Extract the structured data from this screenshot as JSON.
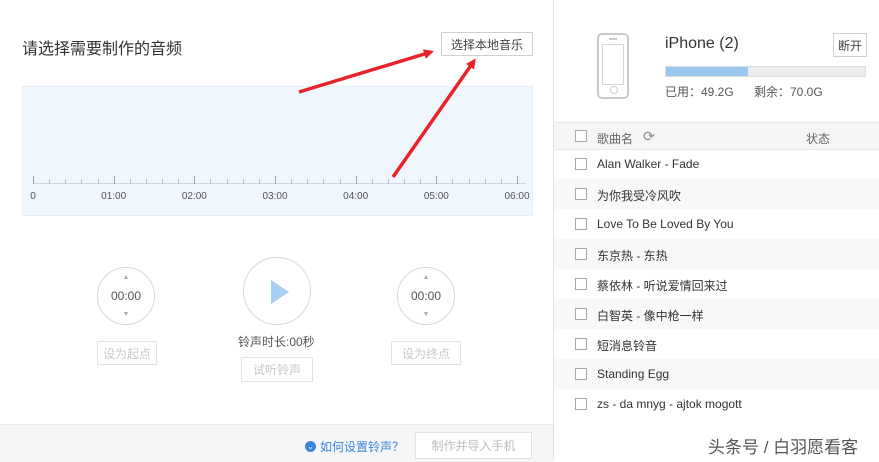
{
  "left_panel": {
    "title": "请选择需要制作的音频",
    "pick_music_label": "选择本地音乐",
    "timeline_labels": [
      "0",
      "01:00",
      "02:00",
      "03:00",
      "04:00",
      "05:00",
      "06:00"
    ],
    "start_time": "00:00",
    "end_time": "00:00",
    "set_start_label": "设为起点",
    "set_end_label": "设为终点",
    "ringtone_length": "铃声时长:00秒",
    "preview_label": "试听铃声",
    "help_link": "如何设置铃声？",
    "make_import_label": "制作并导入手机",
    "help_icon_glyph": "⌄"
  },
  "device": {
    "name": "iPhone (2)",
    "disconnect_label": "断开",
    "used": "已用：49.2G",
    "remaining": "剩余：70.0G",
    "used_fraction": 0.41
  },
  "song_list": {
    "header_song": "歌曲名",
    "header_status": "状态",
    "songs": [
      "Alan Walker - Fade",
      "为你我受冷风吹",
      "Love To Be Loved By You",
      "东京热 - 东热",
      "蔡依林 - 听说爱情回来过",
      "白智英 - 像中枪一样",
      "短消息铃音",
      "Standing Egg",
      "zs - da mnyg - ajtok mogott"
    ]
  },
  "watermark": "头条号 / 白羽愿看客",
  "colors": {
    "accent": "#3a86d8",
    "storage_fill": "#9cc8ef",
    "arrow": "#e8232a",
    "wave_bg": "#f0f6fd"
  }
}
